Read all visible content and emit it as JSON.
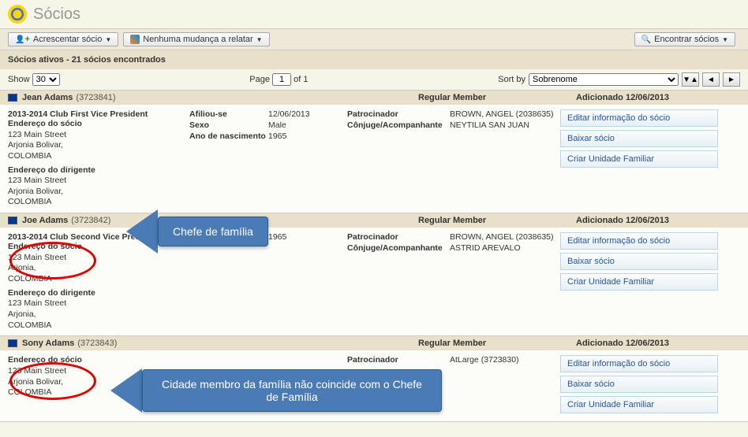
{
  "header": {
    "title": "Sócios"
  },
  "toolbar": {
    "add_label": "Acrescentar sócio",
    "report_label": "Nenhuma mudança a relatar",
    "find_label": "Encontrar sócios"
  },
  "results": {
    "summary": "Sócios ativos - 21 sócios encontrados",
    "show_label": "Show",
    "show_value": "30",
    "page_label": "Page",
    "page_value": "1",
    "page_of": "of 1",
    "sort_label": "Sort by",
    "sort_value": "Sobrenome"
  },
  "columns": {
    "regular": "Regular Member",
    "added_label": "Adicionado",
    "affiliated": "Afiliou-se",
    "sex": "Sexo",
    "birth": "Ano de nascimento",
    "sponsor": "Patrocinador",
    "spouse": "Cônjuge/Acompanhante",
    "addr_member": "Endereço do sócio",
    "addr_officer": "Endereço do dirigente"
  },
  "actions": {
    "edit": "Editar informação do sócio",
    "drop": "Baixar sócio",
    "family": "Criar Unidade Familiar"
  },
  "members": [
    {
      "name": "Jean  Adams",
      "id": "(3723841)",
      "added": "12/06/2013",
      "role": "2013-2014 Club First Vice President",
      "addr1": [
        "123 Main Street",
        "Arjonia Bolivar,",
        "COLOMBIA"
      ],
      "addr2": [
        "123 Main Street",
        "Arjonia Bolivar,",
        "COLOMBIA"
      ],
      "affiliated": "12/06/2013",
      "sex": "Male",
      "birth": "1965",
      "sponsor": "BROWN, ANGEL (2038635)",
      "spouse": "NEYTILIA SAN JUAN"
    },
    {
      "name": "Joe  Adams",
      "id": "(3723842)",
      "added": "12/06/2013",
      "role": "2013-2014 Club Second Vice President",
      "addr1": [
        "123 Main Street",
        "Arjonia,",
        "COLOMBIA"
      ],
      "addr2": [
        "123 Main Street",
        "Arjonia,",
        "COLOMBIA"
      ],
      "affiliated": "",
      "sex": "",
      "birth": "1965",
      "sponsor": "BROWN, ANGEL (2038635)",
      "spouse": "ASTRID AREVALO"
    },
    {
      "name": "Sony  Adams",
      "id": "(3723843)",
      "added": "12/06/2013",
      "role": "",
      "addr1": [
        "123 Main Street",
        "Arjonia Bolivar,",
        "COLOMBIA"
      ],
      "addr2": [],
      "affiliated": "",
      "sex": "",
      "birth": "",
      "sponsor": "AtLarge (3723830)",
      "spouse": ""
    }
  ],
  "annotations": {
    "arrow1": "Chefe de família",
    "arrow2": "Cidade membro da família não coincide com o Chefe de Família"
  }
}
